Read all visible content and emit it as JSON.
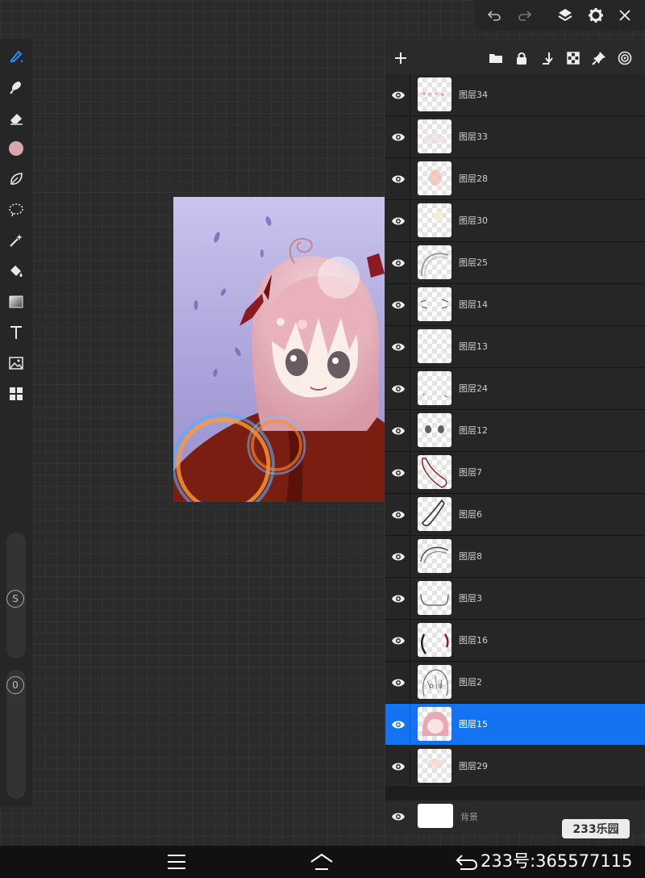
{
  "toolbar": {
    "tools": [
      {
        "name": "brush-tool",
        "icon": "pen-icon",
        "active": true
      },
      {
        "name": "smudge-tool",
        "icon": "smudge-icon"
      },
      {
        "name": "eraser-tool",
        "icon": "eraser-icon"
      },
      {
        "name": "color-picker",
        "icon": "color-swatch",
        "color": "#d9a6ad"
      },
      {
        "name": "lasso-tool",
        "icon": "leaf-icon"
      },
      {
        "name": "selection-tool",
        "icon": "dotted-lasso-icon"
      },
      {
        "name": "magic-wand-tool",
        "icon": "magic-wand-icon"
      },
      {
        "name": "fill-tool",
        "icon": "paint-bucket-icon"
      },
      {
        "name": "gradient-tool",
        "icon": "gradient-icon"
      },
      {
        "name": "text-tool",
        "icon": "text-icon"
      },
      {
        "name": "image-tool",
        "icon": "image-icon"
      },
      {
        "name": "grid-tool",
        "icon": "grid-icon"
      }
    ],
    "size_slider_label": "S",
    "opacity_slider_label": "0"
  },
  "topbar": {
    "icons": [
      "undo-icon",
      "redo-icon",
      "layers-icon",
      "settings-icon",
      "close-icon"
    ]
  },
  "layer_panel": {
    "actions": [
      "add-layer-icon",
      "folder-icon",
      "lock-icon",
      "merge-down-icon",
      "checker-icon",
      "pin-icon",
      "target-icon"
    ],
    "layers": [
      {
        "name": "图层34",
        "visible": true,
        "selected": false
      },
      {
        "name": "图层33",
        "visible": true,
        "selected": false
      },
      {
        "name": "图层28",
        "visible": true,
        "selected": false
      },
      {
        "name": "图层30",
        "visible": true,
        "selected": false
      },
      {
        "name": "图层25",
        "visible": true,
        "selected": false
      },
      {
        "name": "图层14",
        "visible": true,
        "selected": false
      },
      {
        "name": "图层13",
        "visible": true,
        "selected": false
      },
      {
        "name": "图层24",
        "visible": true,
        "selected": false
      },
      {
        "name": "图层12",
        "visible": true,
        "selected": false
      },
      {
        "name": "图层7",
        "visible": true,
        "selected": false
      },
      {
        "name": "图层6",
        "visible": true,
        "selected": false
      },
      {
        "name": "图层8",
        "visible": true,
        "selected": false
      },
      {
        "name": "图层3",
        "visible": true,
        "selected": false
      },
      {
        "name": "图层16",
        "visible": true,
        "selected": false
      },
      {
        "name": "图层2",
        "visible": true,
        "selected": false
      },
      {
        "name": "图层15",
        "visible": true,
        "selected": true
      },
      {
        "name": "图层29",
        "visible": true,
        "selected": false
      }
    ],
    "background_layer": {
      "name": "背景",
      "visible": true
    }
  },
  "watermark": "233乐园",
  "user_id": "233号:365577115",
  "colors": {
    "accent": "#1373f0",
    "panel": "#262626",
    "canvas_bg": "#2b2b2b"
  }
}
